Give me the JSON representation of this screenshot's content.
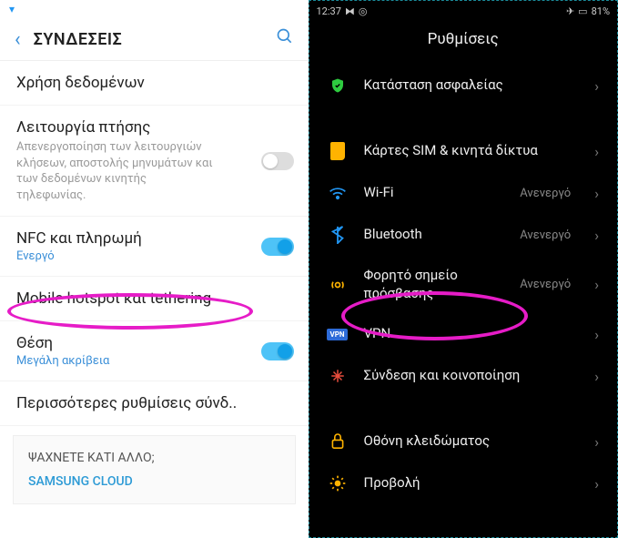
{
  "left": {
    "statusbar": {
      "shield": "▼"
    },
    "header": {
      "title": "ΣΥΝΔΕΣΕΙΣ"
    },
    "rows": {
      "data_usage": "Χρήση δεδομένων",
      "flight_mode": "Λειτουργία πτήσης",
      "flight_desc": "Απενεργοποίηση των λειτουργιών κλήσεων, αποστολής μηνυμάτων και των δεδομένων κινητής τηλεφωνίας.",
      "nfc": "NFC και πληρωμή",
      "nfc_status": "Ενεργό",
      "hotspot": "Mobile hotspot και tethering",
      "location": "Θέση",
      "location_status": "Μεγάλη ακρίβεια",
      "more": "Περισσότερες ρυθμίσεις σύνδ.."
    },
    "morebox": {
      "q": "ΨΑΧΝΕΤΕ ΚΑΤΙ ΑΛΛΟ;",
      "link": "SAMSUNG CLOUD"
    }
  },
  "right": {
    "statusbar": {
      "time": "12:37",
      "batt": "81%"
    },
    "title": "Ρυθμίσεις",
    "items": {
      "security": "Κατάσταση ασφαλείας",
      "sim": "Κάρτες SIM & κινητά δίκτυα",
      "wifi": "Wi-Fi",
      "bt": "Bluetooth",
      "hotspot": "Φορητό σημείο πρόσβασης",
      "vpn": "VPN",
      "share": "Σύνδεση και κοινοποίηση",
      "lock": "Οθόνη κλειδώματος",
      "display": "Προβολή"
    },
    "state_off": "Ανενεργό"
  }
}
